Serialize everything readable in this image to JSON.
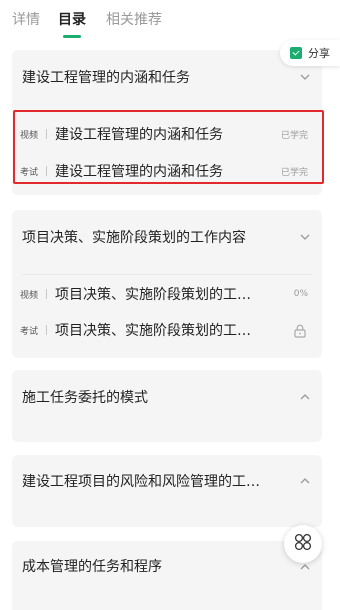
{
  "tabs": [
    {
      "label": "详情"
    },
    {
      "label": "目录"
    },
    {
      "label": "相关推荐"
    }
  ],
  "share": {
    "label": "分享"
  },
  "sections": [
    {
      "title": "建设工程管理的内涵和任务",
      "items": [
        {
          "tag": "视频",
          "title": "建设工程管理的内涵和任务",
          "status": "已学完"
        },
        {
          "tag": "考试",
          "title": "建设工程管理的内涵和任务",
          "status": "已学完"
        }
      ]
    },
    {
      "title": "项目决策、实施阶段策划的工作内容",
      "items": [
        {
          "tag": "视频",
          "title": "项目决策、实施阶段策划的工作内容",
          "status": "0%"
        },
        {
          "tag": "考试",
          "title": "项目决策、实施阶段策划的工作内容",
          "status": ""
        }
      ]
    },
    {
      "title": "施工任务委托的模式"
    },
    {
      "title": "建设工程项目的风险和风险管理的工作流程"
    },
    {
      "title": "成本管理的任务和程序"
    }
  ],
  "colors": {
    "accent": "#1aad6f",
    "highlight": "#e2292e"
  }
}
